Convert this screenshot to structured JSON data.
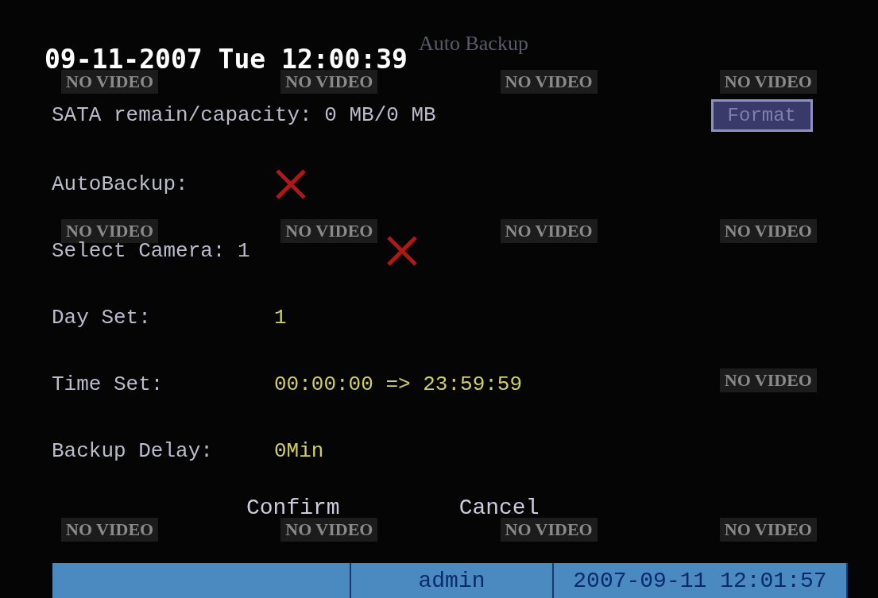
{
  "overlay_clock": "09-11-2007 Tue 12:00:39",
  "camera_grid_rows": [
    {
      "tiles": [
        "NO VIDEO",
        "NO VIDEO",
        "NO VIDEO",
        "NO VIDEO"
      ]
    },
    {
      "tiles": [
        "NO VIDEO",
        "NO VIDEO",
        "NO VIDEO",
        "NO VIDEO"
      ]
    },
    {
      "tiles": [
        "NO VIDEO"
      ]
    },
    {
      "tiles": [
        "NO VIDEO",
        "NO VIDEO",
        "NO VIDEO",
        "NO VIDEO"
      ]
    }
  ],
  "dialog": {
    "title": "Auto Backup",
    "storage": {
      "label": "SATA remain/capacity: 0 MB/0 MB",
      "button": "Format"
    },
    "rows": [
      {
        "kind": "toggle",
        "label": "AutoBackup:",
        "checked": false
      },
      {
        "kind": "camera",
        "label": "Select Camera: 1",
        "checked": false
      },
      {
        "kind": "value",
        "label": "Day Set:",
        "value": "1"
      },
      {
        "kind": "value",
        "label": "Time Set:",
        "value": "00:00:00 => 23:59:59"
      },
      {
        "kind": "value",
        "label": "Backup Delay:",
        "value": "0Min"
      }
    ],
    "buttons": [
      "Confirm",
      "Cancel"
    ]
  },
  "status_bar": {
    "user": "admin",
    "datetime": "2007-09-11 12:01:57"
  }
}
